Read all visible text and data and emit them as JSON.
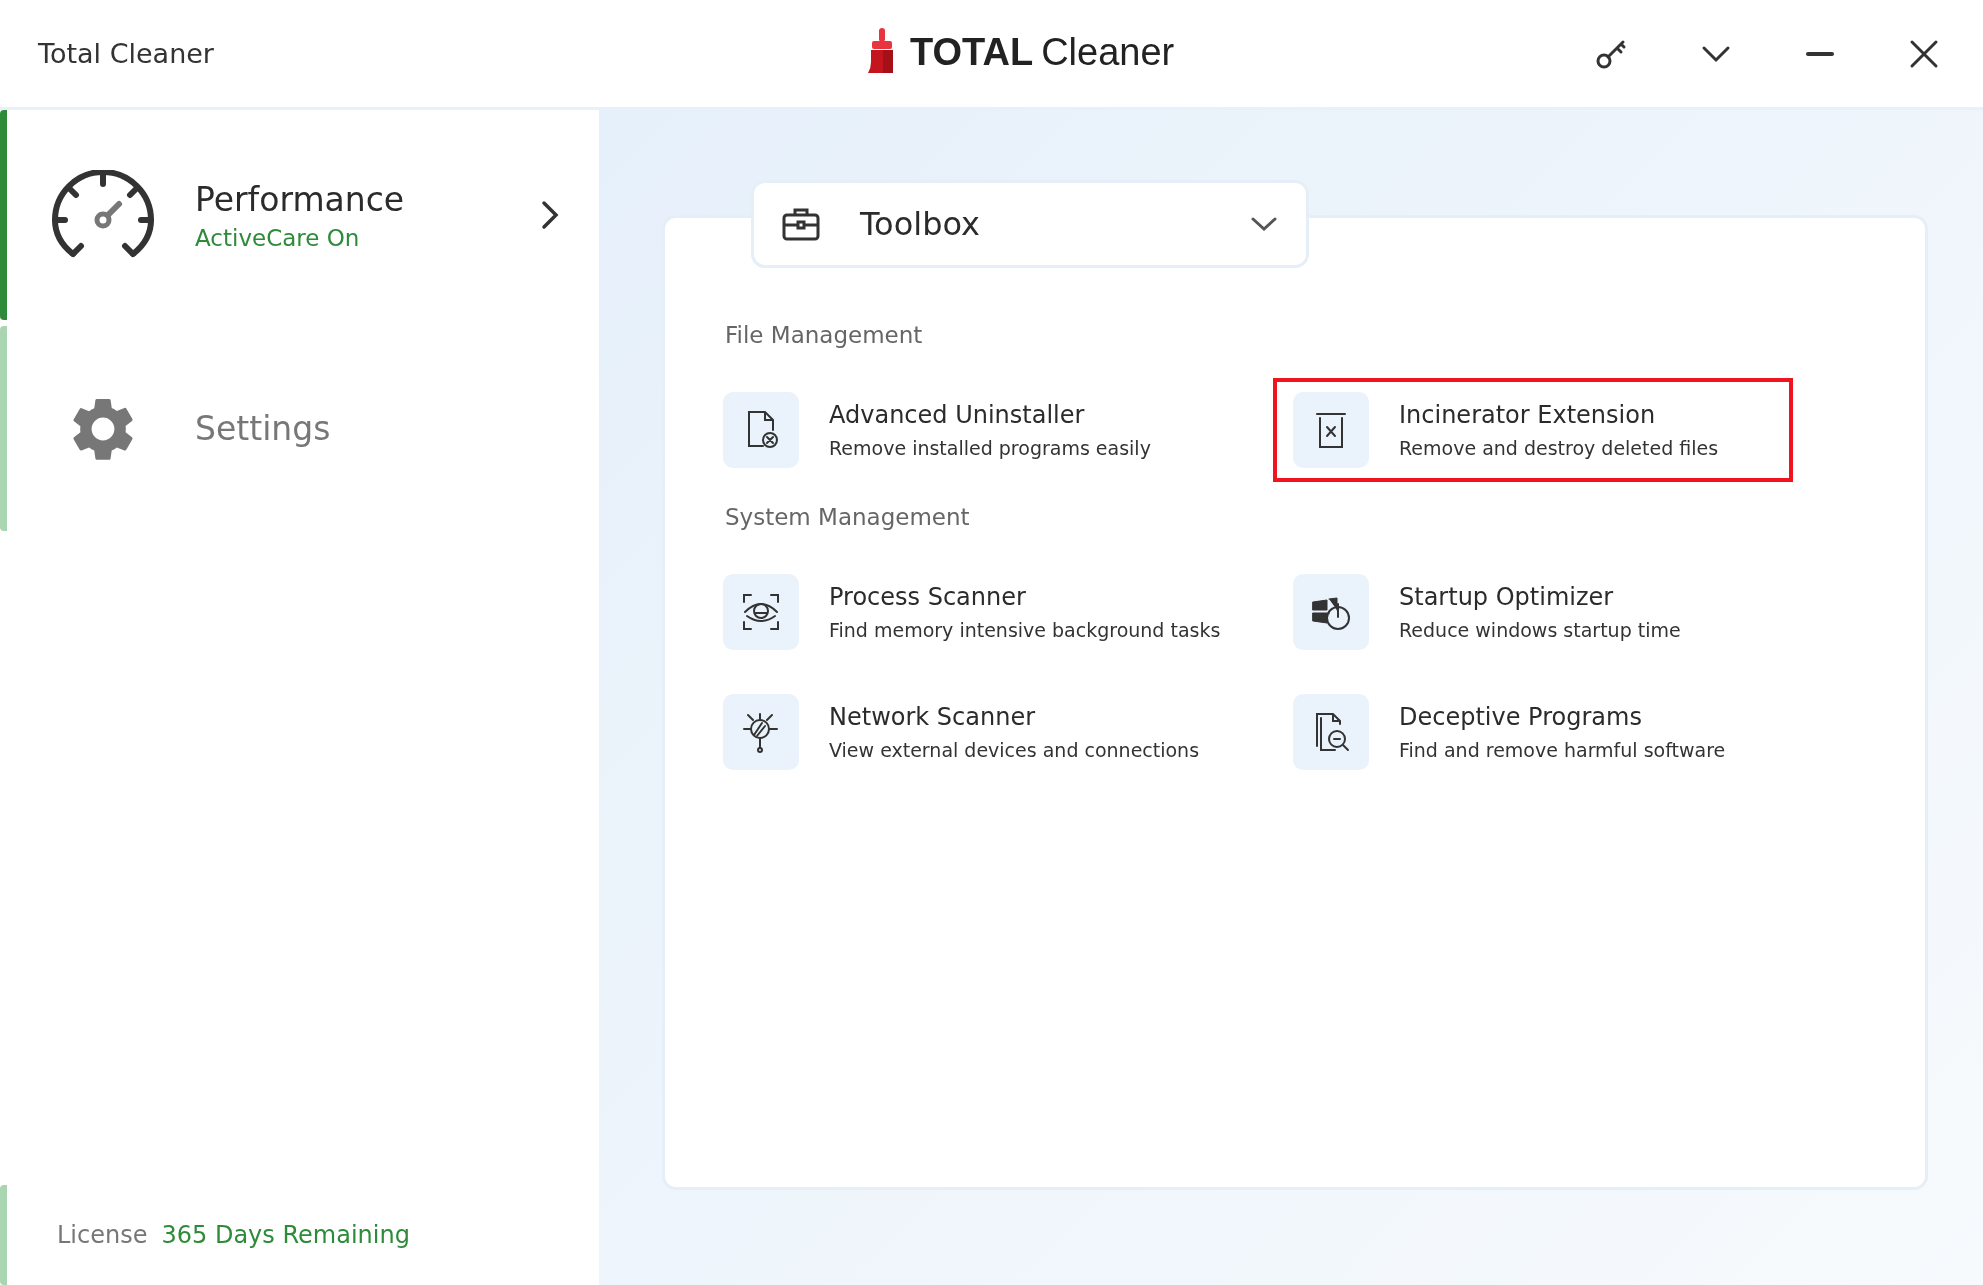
{
  "window": {
    "title": "Total Cleaner",
    "logo_bold": "TOTAL",
    "logo_light": "Cleaner"
  },
  "sidebar": {
    "items": [
      {
        "kind": "performance",
        "label": "Performance",
        "status": "ActiveCare On",
        "selected": true
      },
      {
        "kind": "settings",
        "label": "Settings",
        "selected": false
      }
    ],
    "license": {
      "label": "License",
      "value": "365 Days Remaining"
    }
  },
  "toolbox": {
    "title": "Toolbox",
    "sections": [
      {
        "heading": "File Management",
        "items": [
          {
            "kind": "uninstall",
            "title": "Advanced Uninstaller",
            "description": "Remove installed programs easily",
            "highlighted": false
          },
          {
            "kind": "incinerator",
            "title": "Incinerator Extension",
            "description": "Remove and destroy deleted files",
            "highlighted": true
          }
        ]
      },
      {
        "heading": "System Management",
        "items": [
          {
            "kind": "process",
            "title": "Process Scanner",
            "description": "Find memory intensive background tasks",
            "highlighted": false
          },
          {
            "kind": "startup",
            "title": "Startup Optimizer",
            "description": "Reduce windows startup time",
            "highlighted": false
          },
          {
            "kind": "network",
            "title": "Network Scanner",
            "description": "View external devices and connections",
            "highlighted": false
          },
          {
            "kind": "deceptive",
            "title": "Deceptive Programs",
            "description": "Find and remove harmful software",
            "highlighted": false
          }
        ]
      }
    ]
  }
}
